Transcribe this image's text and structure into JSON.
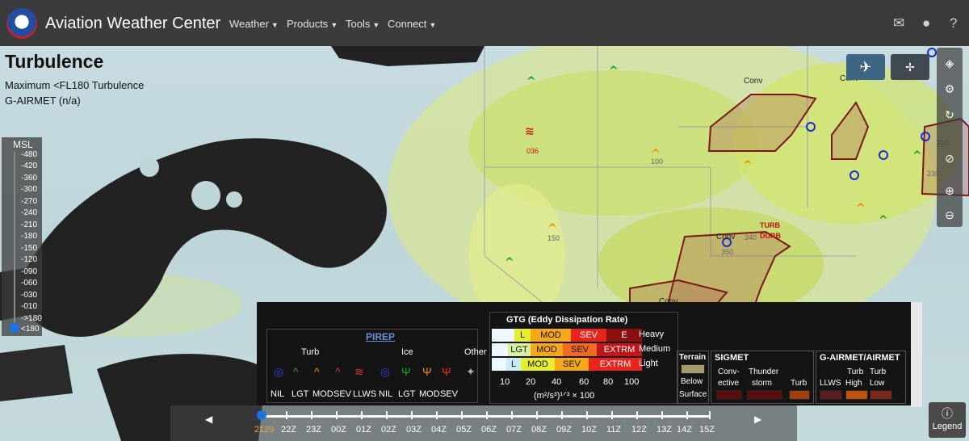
{
  "header": {
    "brand": "Aviation Weather Center",
    "nav": [
      "Weather",
      "Products",
      "Tools",
      "Connect"
    ]
  },
  "page": {
    "title": "Turbulence",
    "subtitle1": "Maximum <FL180 Turbulence",
    "subtitle2": "G-AIRMET (n/a)"
  },
  "msl": {
    "label": "MSL",
    "ticks": [
      "-480",
      "-420",
      "-360",
      "-300",
      "-270",
      "-240",
      "-210",
      "-180",
      "-150",
      "-120",
      "-090",
      "-060",
      "-030",
      "-010",
      "->180",
      "<180"
    ],
    "selected": "<180"
  },
  "map_labels": {
    "conv1": "Conv",
    "conv2": "Conv",
    "conv3": "Conv",
    "conv4": "Conv",
    "turb": "TURB",
    "durb": "DURB",
    "n036": "036",
    "n340": "340",
    "n350": "350",
    "n100": "100",
    "n150": "150",
    "n230": "230",
    "n210": "210"
  },
  "legend": {
    "pirep": "PIREP",
    "turb": "Turb",
    "ice": "Ice",
    "other": "Other",
    "turb_levels": [
      "NIL",
      "LGT",
      "MOD",
      "SEV",
      "LLWS"
    ],
    "ice_levels": [
      "NIL",
      "LGT",
      "MOD",
      "SEV"
    ],
    "gtg_title": "GTG (Eddy Dissipation Rate)",
    "rows": [
      {
        "name": "Heavy",
        "cells": [
          "",
          "L",
          "MOD",
          "SEV",
          "E"
        ]
      },
      {
        "name": "Medium",
        "cells": [
          "",
          "LGT",
          "MOD",
          "SEV",
          "EXTRM"
        ]
      },
      {
        "name": "Light",
        "cells": [
          "",
          "L",
          "MOD",
          "SEV",
          "EXTRM"
        ]
      }
    ],
    "scale": [
      "10",
      "20",
      "40",
      "60",
      "80",
      "100"
    ],
    "units": "(m²/s³)¹ᐟ³ × 100",
    "terrain": "Terrain",
    "below": "Below",
    "surface": "Surface",
    "sigmet": "SIGMET",
    "convective": "Conv-\nective",
    "conv_line1": "Conv-",
    "conv_line2": "ective",
    "thunder1": "Thunder",
    "thunder2": "storm",
    "sig_turb": "Turb",
    "gairmet": "G-AIRMET/AIRMET",
    "llws": "LLWS",
    "turb_high1": "Turb",
    "turb_high2": "High",
    "turb_low1": "Turb",
    "turb_low2": "Low"
  },
  "timeline": {
    "labels": [
      "2129",
      "22Z",
      "23Z",
      "00Z",
      "01Z",
      "02Z",
      "03Z",
      "04Z",
      "05Z",
      "06Z",
      "07Z",
      "08Z",
      "09Z",
      "10Z",
      "11Z",
      "12Z",
      "13Z",
      "14Z",
      "15Z"
    ],
    "current": "2129"
  },
  "legend_button": "Legend",
  "colors": {
    "accent": "#1b74e4",
    "sigmet": "#8b1a1a",
    "header": "#3b3b3b"
  }
}
